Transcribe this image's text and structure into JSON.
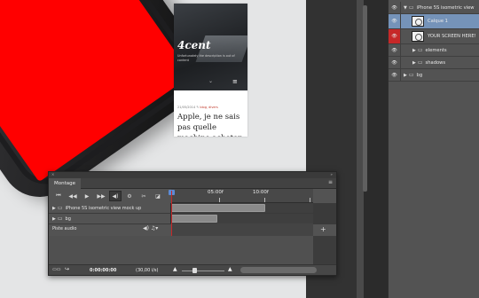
{
  "mockup": {
    "logo": "4cent",
    "tagline": "Unfortunately the description is out of content",
    "date": "21/05/2014",
    "tag": "blog, divers",
    "title": "Apple, je ne sais pas quelle machine acheter de toi"
  },
  "layers": [
    {
      "label": "iPhone 5S isometric view",
      "type": "group",
      "open": true
    },
    {
      "label": "Calque 1",
      "type": "smart-object",
      "selected": true
    },
    {
      "label": "YOUR SCREEN HERE!",
      "type": "smart-object",
      "eye_color": "#c62828"
    },
    {
      "label": "elements",
      "type": "group"
    },
    {
      "label": "shadows",
      "type": "group"
    },
    {
      "label": "bg",
      "type": "group"
    }
  ],
  "timeline": {
    "tab": "Montage",
    "ruler": {
      "mark1": "05:00f",
      "mark2": "10:00f"
    },
    "tracks": [
      {
        "label": "iPhone 5S isometric view mock up"
      },
      {
        "label": "bg"
      }
    ],
    "audio_label": "Piste audio",
    "current_time": "0:00:00:00",
    "fps": "(30,00 i/s)"
  }
}
